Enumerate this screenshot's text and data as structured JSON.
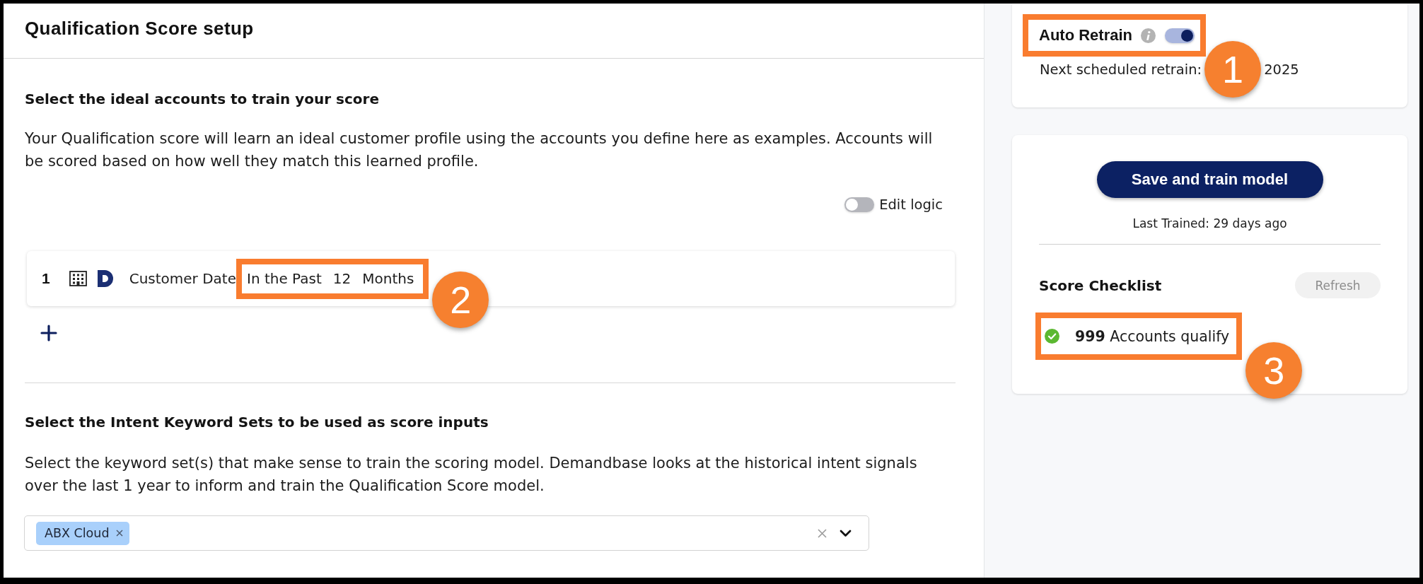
{
  "page": {
    "title": "Qualification Score setup"
  },
  "ideal_accounts": {
    "heading": "Select the ideal accounts to train your score",
    "description": "Your Qualification score will learn an ideal customer profile using the accounts you define here as examples. Accounts will be scored based on how well they match this learned profile.",
    "edit_logic": {
      "label": "Edit logic",
      "on": false
    },
    "rules": [
      {
        "number": "1",
        "field": "Customer Date",
        "operator": "In the Past",
        "value": "12",
        "unit": "Months",
        "callout": "2"
      }
    ]
  },
  "intent_keywords": {
    "heading": "Select the Intent Keyword Sets to be used as score inputs",
    "description": "Select the keyword set(s) that make sense to train the scoring model. Demandbase looks at the historical intent signals over the last 1 year to inform and train the Qualification Score model.",
    "selected": [
      {
        "label": "ABX Cloud"
      }
    ]
  },
  "auto_retrain": {
    "label": "Auto Retrain",
    "on": true,
    "callout": "1",
    "next_label": "Next scheduled retrain:",
    "next_value": "2025"
  },
  "training": {
    "button": "Save and train model",
    "last_trained": "Last Trained: 29 days ago"
  },
  "checklist": {
    "title": "Score Checklist",
    "refresh": {
      "label": "Refresh",
      "disabled": true
    },
    "items": [
      {
        "label": "**999** Accounts qualify",
        "passed": true,
        "callout": "3"
      }
    ]
  }
}
